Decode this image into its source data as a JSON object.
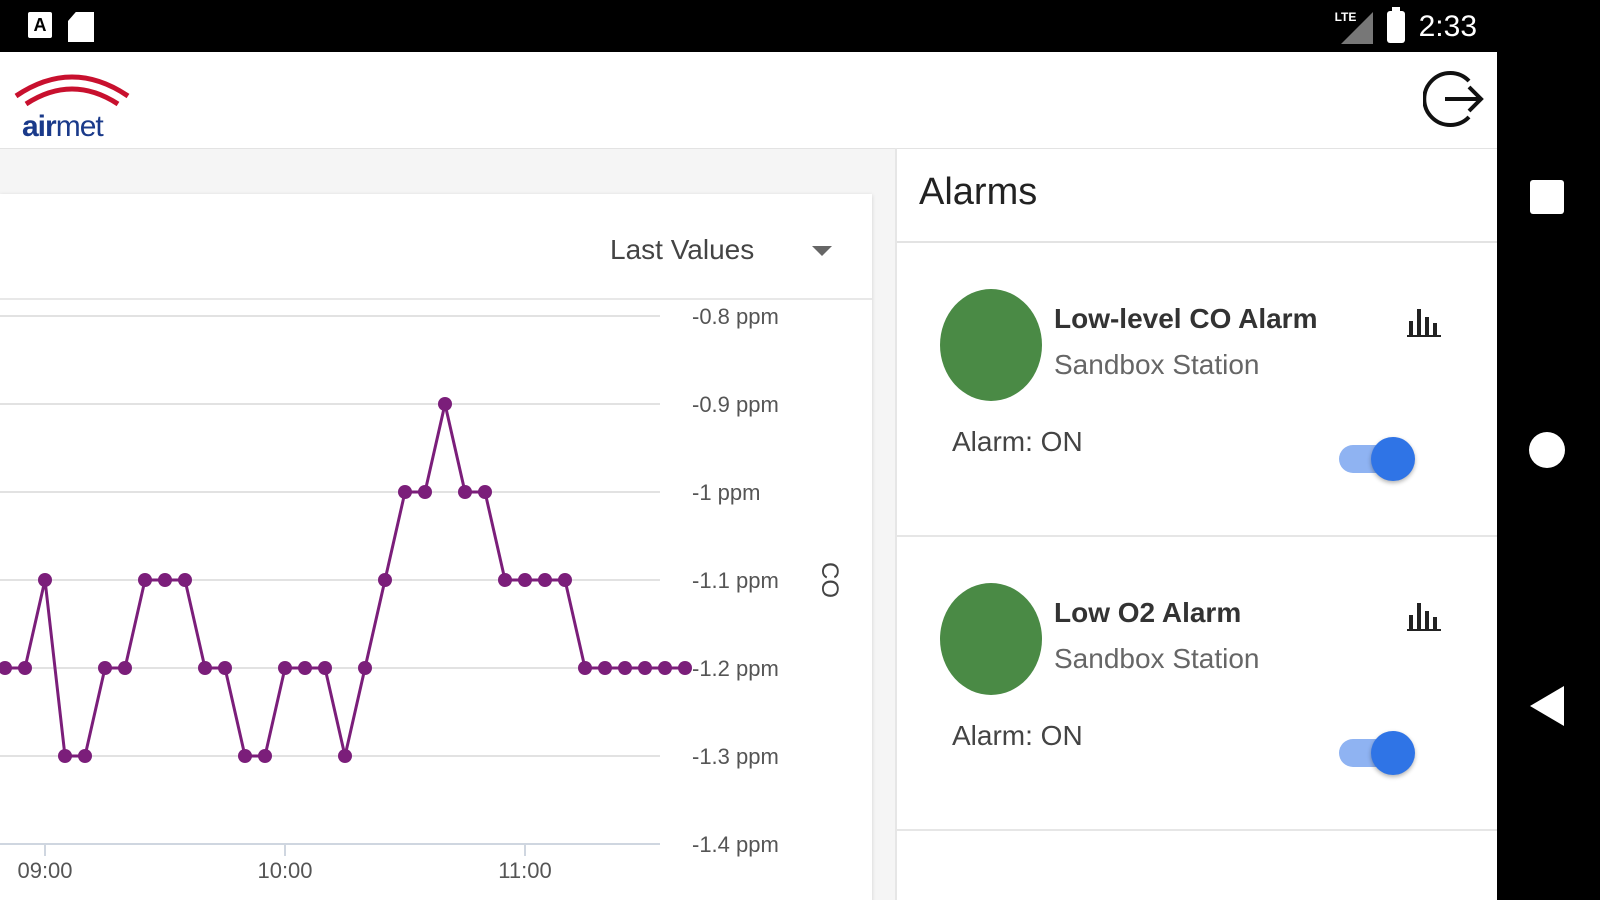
{
  "status_bar": {
    "time": "2:33",
    "network": "LTE",
    "left_icons": [
      "a-icon",
      "sd-card-icon"
    ],
    "a_glyph": "A"
  },
  "app_bar": {
    "logo_text_bold": "air",
    "logo_text_light": "met",
    "logo_arc_color": "#c8102e",
    "logo_text_color": "#1a3a8a",
    "logout_icon": "logout-icon"
  },
  "chart_card": {
    "range_label": "Last Values"
  },
  "chart_data": {
    "type": "line",
    "series": [
      {
        "color": "#7b1e7a",
        "x": [
          "08:50",
          "08:55",
          "09:00",
          "09:05",
          "09:10",
          "09:15",
          "09:20",
          "09:25",
          "09:30",
          "09:35",
          "09:40",
          "09:45",
          "09:50",
          "09:55",
          "10:00",
          "10:05",
          "10:10",
          "10:15",
          "10:20",
          "10:25",
          "10:30",
          "10:35",
          "10:40",
          "10:45",
          "10:50",
          "10:55",
          "11:00",
          "11:05",
          "11:10",
          "11:15",
          "11:20",
          "11:25",
          "11:30",
          "11:35",
          "11:40"
        ],
        "values": [
          -1.2,
          -1.2,
          -1.1,
          -1.3,
          -1.3,
          -1.2,
          -1.2,
          -1.1,
          -1.1,
          -1.1,
          -1.2,
          -1.2,
          -1.3,
          -1.3,
          -1.2,
          -1.2,
          -1.2,
          -1.3,
          -1.2,
          -1.1,
          -1.0,
          -1.0,
          -0.9,
          -1.0,
          -1.0,
          -1.1,
          -1.1,
          -1.1,
          -1.1,
          -1.2,
          -1.2,
          -1.2,
          -1.2,
          -1.2,
          -1.2
        ]
      }
    ],
    "y_ticks": [
      "-0.8 ppm",
      "-0.9 ppm",
      "-1 ppm",
      "-1.1 ppm",
      "-1.2 ppm",
      "-1.3 ppm",
      "-1.4 ppm"
    ],
    "x_ticks": [
      "09:00",
      "10:00",
      "11:00"
    ],
    "ylim": [
      -1.4,
      -0.8
    ],
    "ylabel": "CO",
    "grid": true
  },
  "alarms": {
    "title": "Alarms",
    "items": [
      {
        "name": "Low-level CO Alarm",
        "station": "Sandbox Station",
        "status": "Alarm: ON",
        "indicator_color": "#4a8a45",
        "enabled": true
      },
      {
        "name": "Low O2 Alarm",
        "station": "Sandbox Station",
        "status": "Alarm: ON",
        "indicator_color": "#4a8a45",
        "enabled": true
      }
    ]
  },
  "nav_bar": {
    "buttons": [
      "recents-icon",
      "home-icon",
      "back-icon"
    ]
  }
}
